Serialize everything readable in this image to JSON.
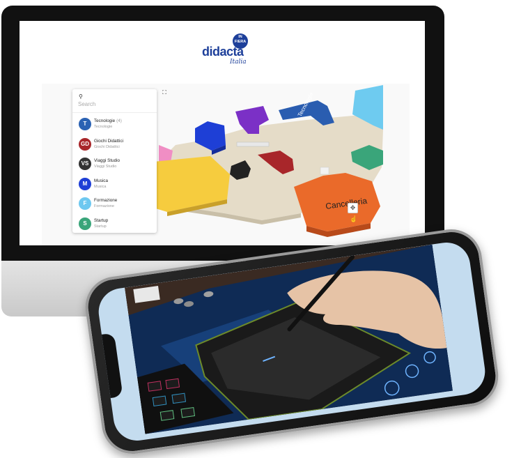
{
  "brand": {
    "name": "didacta",
    "badge": "IN FIERA",
    "script": "Italia"
  },
  "search": {
    "label": "Search",
    "placeholder": "Search"
  },
  "categories": [
    {
      "initials": "T",
      "title": "Tecnologie",
      "count": "(4)",
      "subtitle": "Tecnologie",
      "color": "#2b62b3"
    },
    {
      "initials": "GD",
      "title": "Giochi Didattici",
      "count": "",
      "subtitle": "Giochi Didattici",
      "color": "#a8262a"
    },
    {
      "initials": "VS",
      "title": "Viaggi Studio",
      "count": "",
      "subtitle": "Viaggi Studio",
      "color": "#333333"
    },
    {
      "initials": "M",
      "title": "Musica",
      "count": "",
      "subtitle": "Musica",
      "color": "#1e3fd6"
    },
    {
      "initials": "F",
      "title": "Formazione",
      "count": "",
      "subtitle": "Formazione",
      "color": "#6ec8f0"
    },
    {
      "initials": "S",
      "title": "Startup",
      "count": "",
      "subtitle": "Startup",
      "color": "#3aa57a"
    }
  ],
  "map": {
    "labels": {
      "tecnologie": "Tecnologie",
      "cancelleria": "Cancelleria"
    },
    "colors": {
      "floor": "#e5dcc8",
      "tecnologie": "#2a5db0",
      "cancelleria": "#ea6a2a",
      "formazione": "#6ecbf0",
      "giochi": "#a8262a",
      "musica": "#1e3fd6",
      "startup": "#3aa57a",
      "yellow": "#f6cc3e",
      "purple": "#7b30c6",
      "pink": "#f08ec4"
    }
  },
  "controls": {
    "fullscreen_icon": "expand-icon",
    "pan_icon": "move-icon",
    "pointer_icon": "hand-pointer-icon"
  }
}
